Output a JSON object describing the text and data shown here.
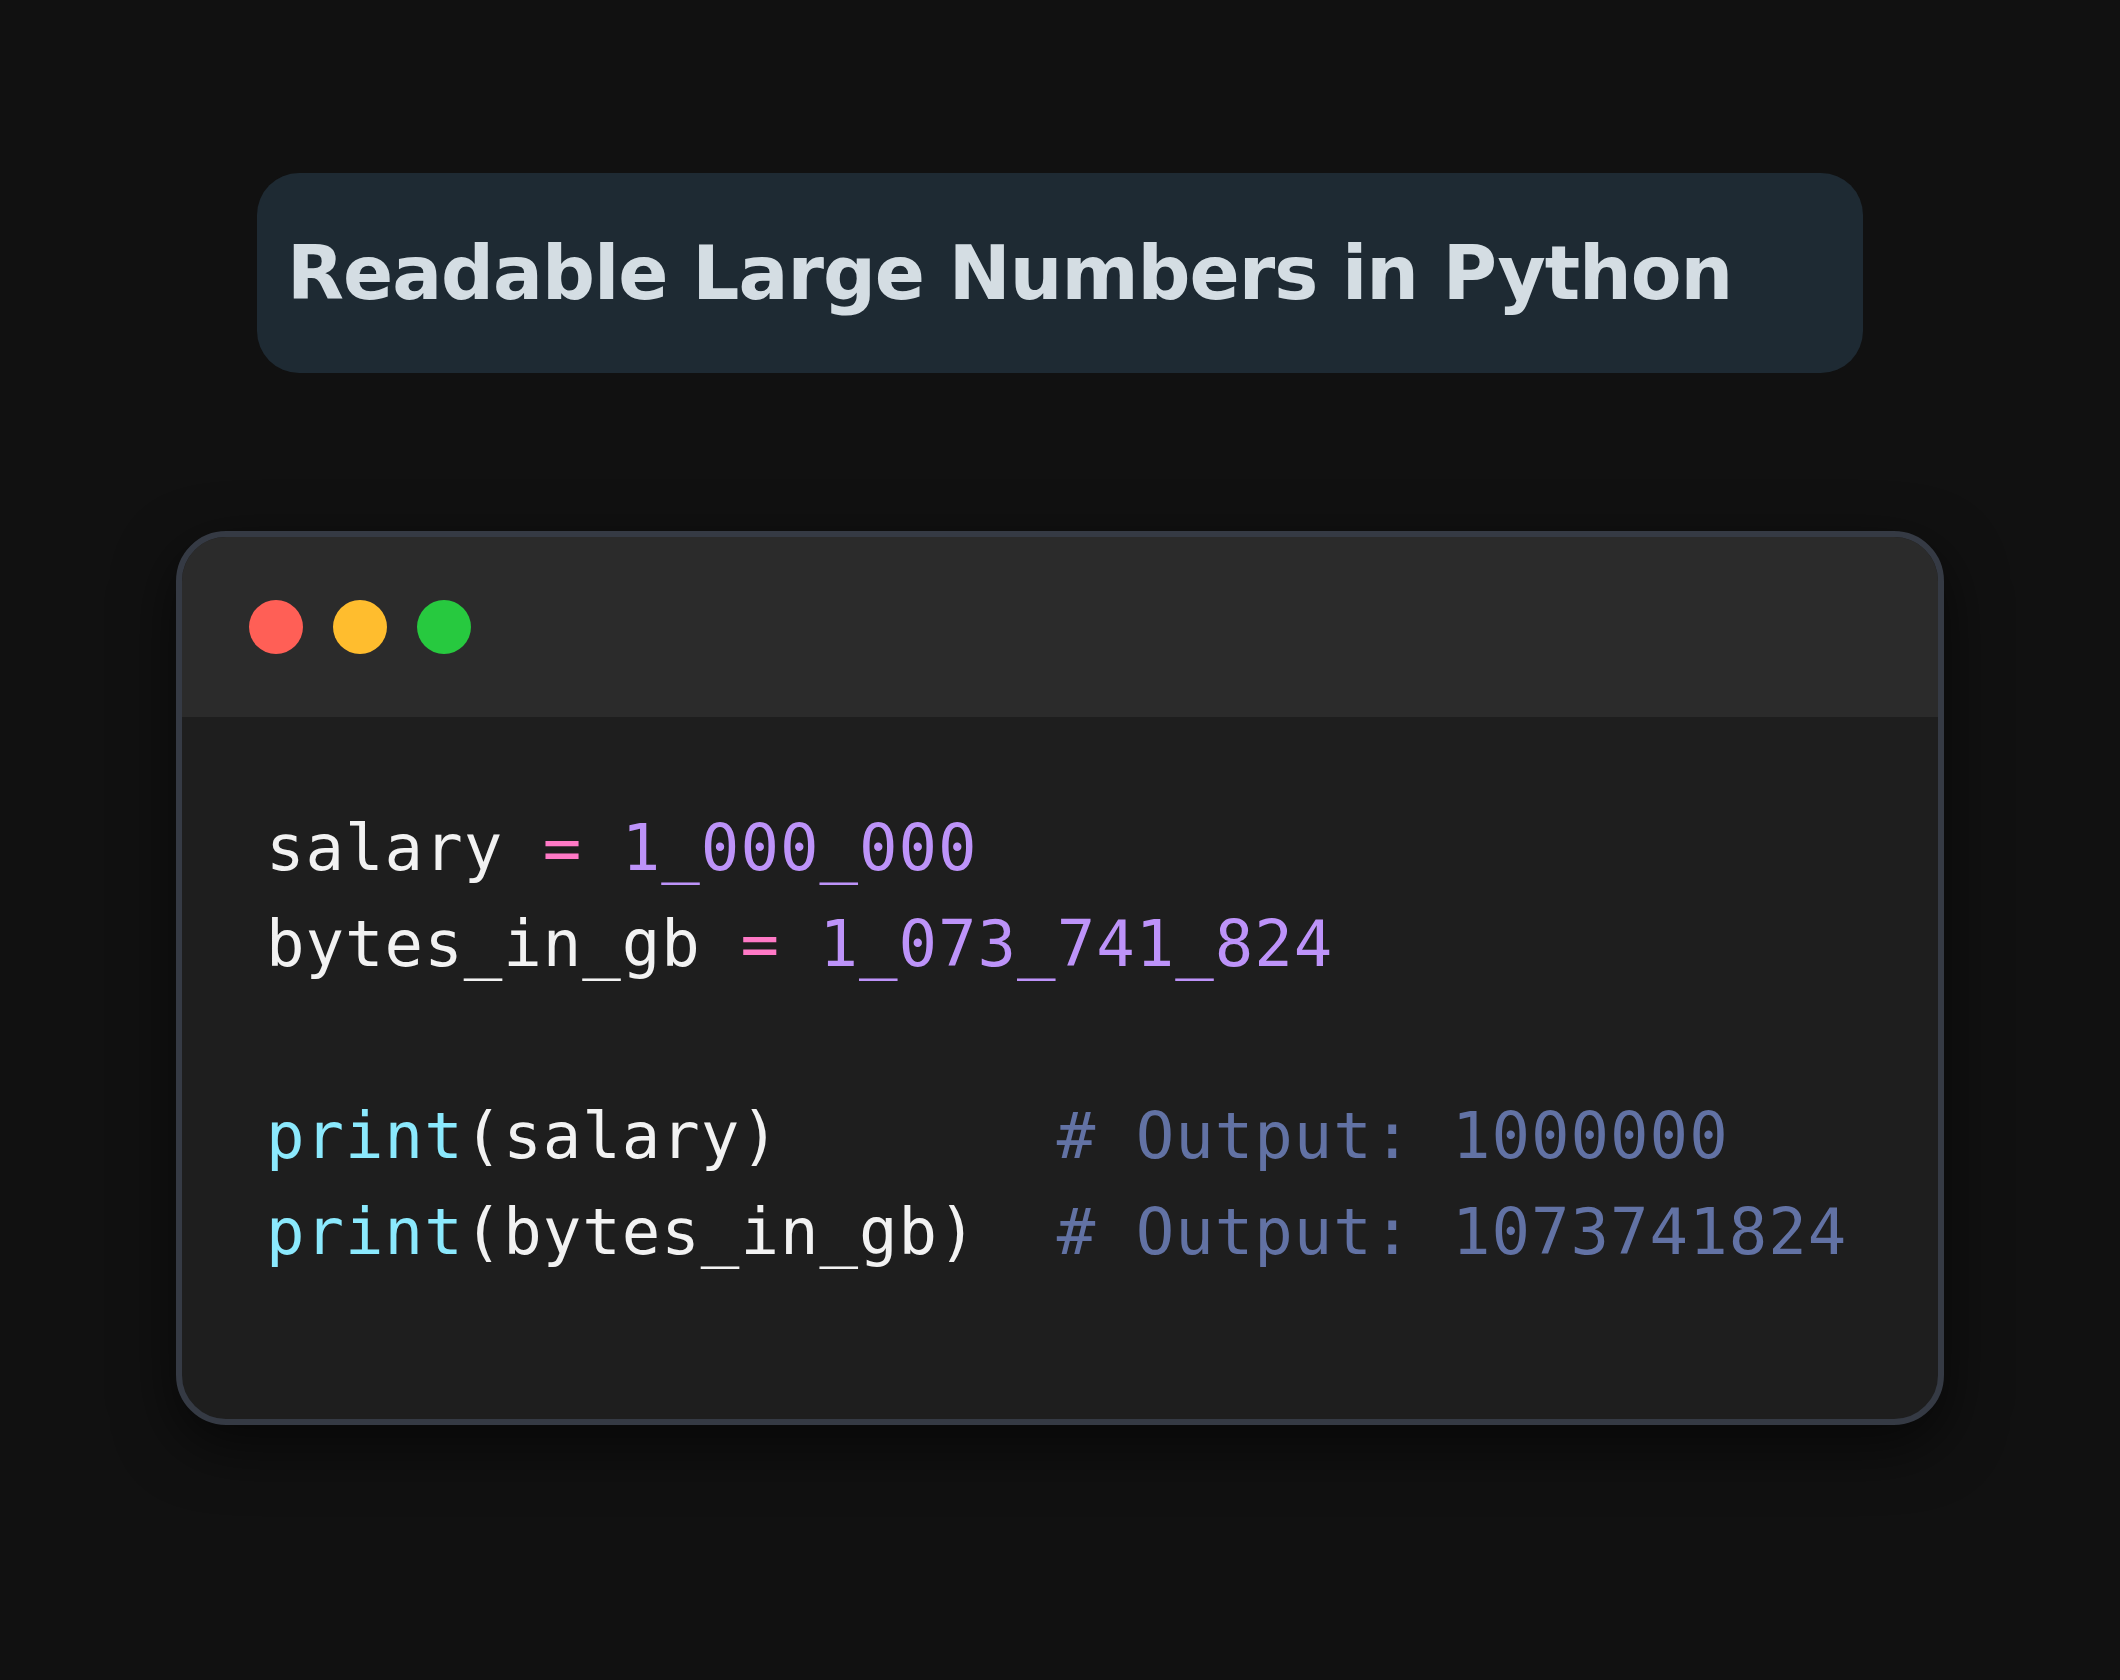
{
  "title": "Readable Large Numbers in Python",
  "window": {
    "dots": [
      {
        "color": "#ff5f56"
      },
      {
        "color": "#ffbd2e"
      },
      {
        "color": "#27c93f"
      }
    ]
  },
  "code": {
    "blocks": [
      [
        {
          "tokens": [
            {
              "kind": "name",
              "text": "salary "
            },
            {
              "kind": "operator",
              "text": "= "
            },
            {
              "kind": "number",
              "text": "1_000_000"
            }
          ]
        },
        {
          "tokens": [
            {
              "kind": "name",
              "text": "bytes_in_gb "
            },
            {
              "kind": "operator",
              "text": "= "
            },
            {
              "kind": "number",
              "text": "1_073_741_824"
            }
          ]
        }
      ],
      [
        {
          "tokens": [
            {
              "kind": "builtin",
              "text": "print"
            },
            {
              "kind": "name",
              "text": "(salary)       "
            },
            {
              "kind": "comment",
              "text": "# Output: 1000000"
            }
          ]
        },
        {
          "tokens": [
            {
              "kind": "builtin",
              "text": "print"
            },
            {
              "kind": "name",
              "text": "(bytes_in_gb)  "
            },
            {
              "kind": "comment",
              "text": "# Output: 1073741824"
            }
          ]
        }
      ]
    ]
  }
}
